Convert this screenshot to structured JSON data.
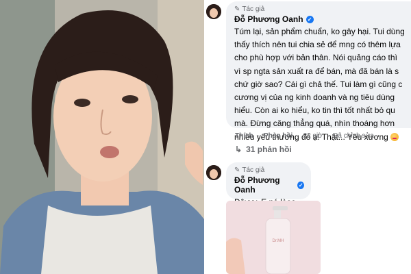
{
  "post": {
    "comments": [
      {
        "badge": "Tác giả",
        "author": "Đỗ Phương Oanh",
        "lines": [
          "Túm lại, sản phẩm chuẩn, ko gây hại. Tui dùng",
          "thấy thích nên tui chia sẻ để mng có thêm lựa",
          "cho phù hợp với bản thân. Nói quảng cáo thì",
          "vì sp ngta sản xuất ra để bán, mà đã bán là s",
          "chứ giờ sao? Cái gì chả thế. Tui làm gì cũng c",
          "cương vị của ng kinh doanh và ng tiêu dùng",
          "hiểu. Còn ai ko hiểu, ko tin thì tốt nhất bỏ qu",
          "mà. Đừng căng thẳng quá, nhìn thoáng hơn",
          "nhiều yêu thương đó ạ! Thật... Yêu xương"
        ],
        "actions": {
          "like": "Thích",
          "reply": "Phản hồi",
          "time": "22 giờ",
          "edited": "Đã chỉnh sửa"
        },
        "replies_label": "31 phản hồi"
      },
      {
        "badge": "Tác giả",
        "author": "Đỗ Phương Oanh",
        "lines": [
          "Đâyyy. E nó lèee"
        ],
        "image_label": "Dr.MH"
      }
    ]
  }
}
